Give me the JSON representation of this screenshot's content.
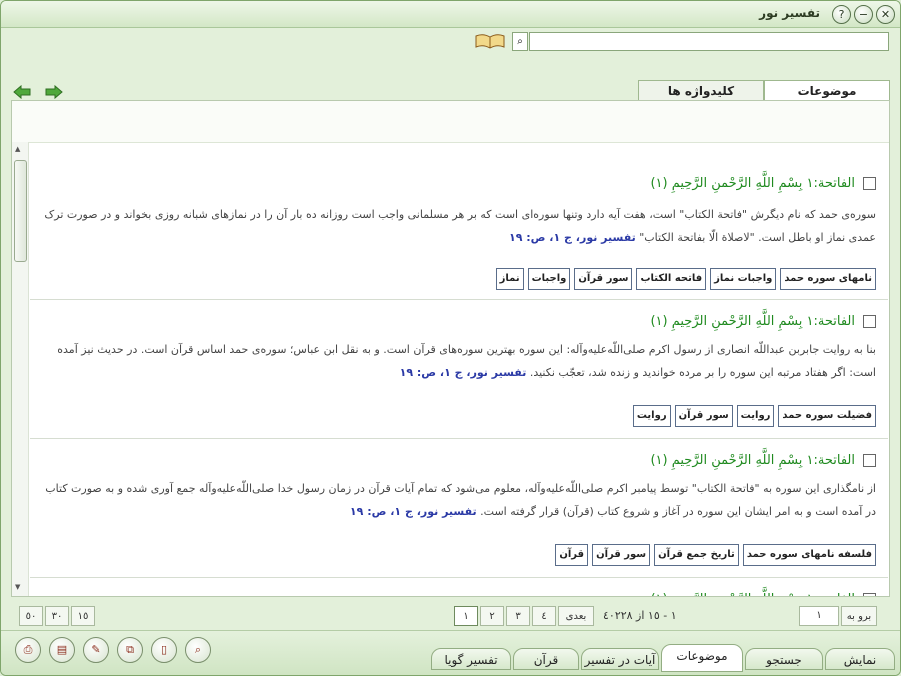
{
  "window": {
    "title": "تفسیر نور"
  },
  "search": {
    "placeholder": "",
    "value": ""
  },
  "tabs": [
    {
      "label": "موضوعات"
    },
    {
      "label": "کلیدواژه ها"
    }
  ],
  "results": [
    {
      "title": "الفاتحة:١ بِسْمِ اللَّهِ الرَّحْمنِ الرَّحِيمِ (١)",
      "text": "سوره‌ى حمد كه نام ديگرش \"فاتحة الكتاب\" است، هفت آيه دارد وتنها سوره‌اى است كه بر هر مسلمانى واجب است روزانه ده بار آن را در نمازهاى شبانه روزى بخواند و در صورت ترک عمدى نماز او باطل است. \"لاصلاة الّا بفاتحة الكتاب\"",
      "source": "تفسیر نور، ج ١، ص: ١٩",
      "keywords": [
        "نامهای سوره حمد",
        "واجبات نماز",
        "فاتحه الکتاب",
        "سور قرآن",
        "واجبات",
        "نماز"
      ]
    },
    {
      "title": "الفاتحة:١ بِسْمِ اللَّهِ الرَّحْمنِ الرَّحِيمِ (١)",
      "text": "بنا به روايت جابربن عبداللّه انصارى از رسول اكرم صلى‌اللّه‌عليه‌وآله: اين سوره بهترين سوره‌هاى قرآن است. و به نقل ابن عباس؛ سوره‌ى حمد اساس قرآن است. در حديث نيز آمده است: اگر هفتاد مرتبه اين سوره را بر مرده خوانديد و زنده شد، تعجّب نكنيد.",
      "source": "تفسیر نور، ج ١، ص: ١٩",
      "keywords": [
        "فضیلت سوره حمد",
        "روایت",
        "سور قرآن",
        "روایت"
      ]
    },
    {
      "title": "الفاتحة:١ بِسْمِ اللَّهِ الرَّحْمنِ الرَّحِيمِ (١)",
      "text": "از نامگذارى اين سوره به \"فاتحة الكتاب\" توسط پيامبر اكرم صلى‌اللّه‌عليه‌وآله، معلوم مى‌شود كه تمام آيات قرآن در زمان رسول خدا صلى‌اللّه‌عليه‌وآله جمع آورى شده و به صورت كتاب در آمده است و به امر ايشان اين سوره در آغاز و شروع كتاب (قرآن) قرار گرفته است.",
      "source": "تفسیر نور، ج ١، ص: ١٩",
      "keywords": [
        "فلسفه نامهای سوره حمد",
        "تاریخ جمع قرآن",
        "سور قرآن",
        "قرآن"
      ]
    }
  ],
  "pager": {
    "page_sizes": [
      "١٥",
      "٣٠",
      "٥٠"
    ],
    "pages": [
      "١",
      "٢",
      "٣",
      "٤"
    ],
    "next_label": "بعدی",
    "range_text": "١ - ١٥ از ٤٠٢٢٨",
    "goto_label": "برو به",
    "goto_value": "١"
  },
  "bottom_tabs": [
    {
      "label": "نمایش"
    },
    {
      "label": "جستجو"
    },
    {
      "label": "موضوعات"
    },
    {
      "label": "آیات در تفسیر"
    },
    {
      "label": "قرآن"
    },
    {
      "label": "تفسیر گویا"
    }
  ],
  "colors": {
    "accent_green": "#1f8a1f",
    "source_blue": "#2b3aa6",
    "frame_green": "#7fa56b"
  }
}
